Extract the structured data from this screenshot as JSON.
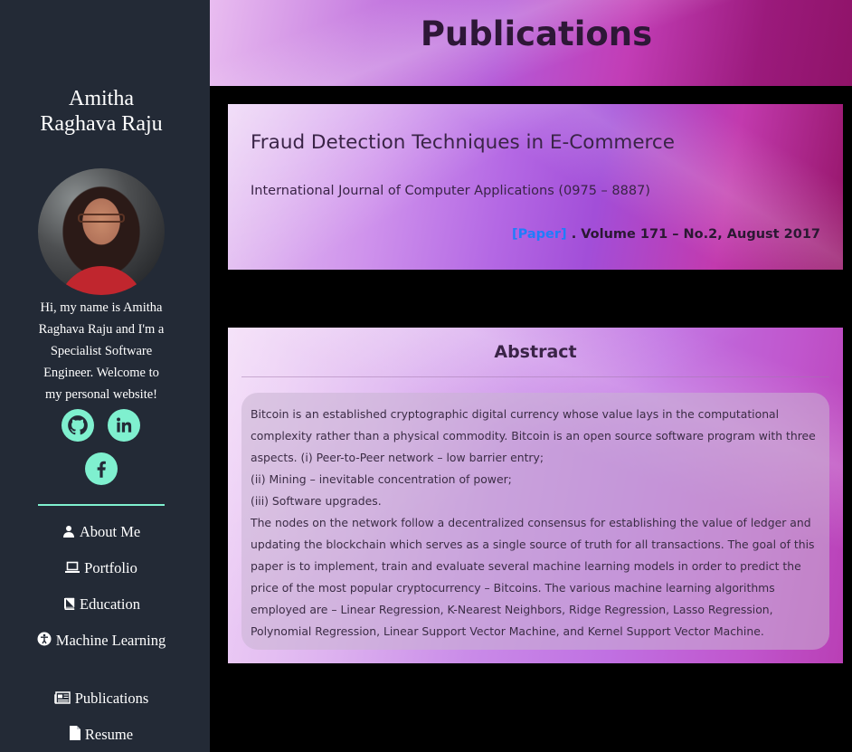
{
  "sidebar": {
    "name": "Amitha Raghava Raju",
    "bio": "Hi, my name is Amitha Raghava Raju and I'm a Specialist Software Engineer. Welcome to my personal website!",
    "social": [
      {
        "icon": "github-icon"
      },
      {
        "icon": "linkedin-icon"
      },
      {
        "icon": "facebook-icon"
      }
    ],
    "nav": [
      {
        "label": "About Me",
        "icon": "user-icon"
      },
      {
        "label": "Portfolio",
        "icon": "laptop-icon"
      },
      {
        "label": "Education",
        "icon": "book-icon"
      },
      {
        "label": "Machine Learning",
        "icon": "accessibility-icon"
      },
      {
        "label": "Publications",
        "icon": "newspaper-icon"
      },
      {
        "label": "Resume",
        "icon": "file-icon"
      }
    ]
  },
  "header": {
    "title": "Publications"
  },
  "paper": {
    "title": "Fraud Detection Techniques in E-Commerce",
    "journal": "International Journal of Computer Applications (0975 – 8887)",
    "link_label": "[Paper]",
    "volume": ". Volume 171 – No.2, August 2017"
  },
  "abstract": {
    "heading": "Abstract",
    "paragraphs": [
      "Bitcoin is an established cryptographic digital currency whose value lays in the computational complexity rather than a physical commodity. Bitcoin is an open source software program with three aspects. (i) Peer-to-Peer network – low barrier entry;",
      "(ii) Mining – inevitable concentration of power;",
      "(iii) Software upgrades.",
      "The nodes on the network follow a decentralized consensus for establishing the value of ledger and updating the blockchain which serves as a single source of truth for all transactions. The goal of this paper is to implement, train and evaluate several machine learning models in order to predict the price of the most popular cryptocurrency – Bitcoins. The various machine learning algorithms employed are – Linear Regression, K-Nearest Neighbors, Ridge Regression, Lasso Regression, Polynomial Regression, Linear Support Vector Machine, and Kernel Support Vector Machine."
    ]
  },
  "colors": {
    "sidebar_bg": "#232a36",
    "accent": "#7ff0cf",
    "link": "#1f7dfa"
  }
}
